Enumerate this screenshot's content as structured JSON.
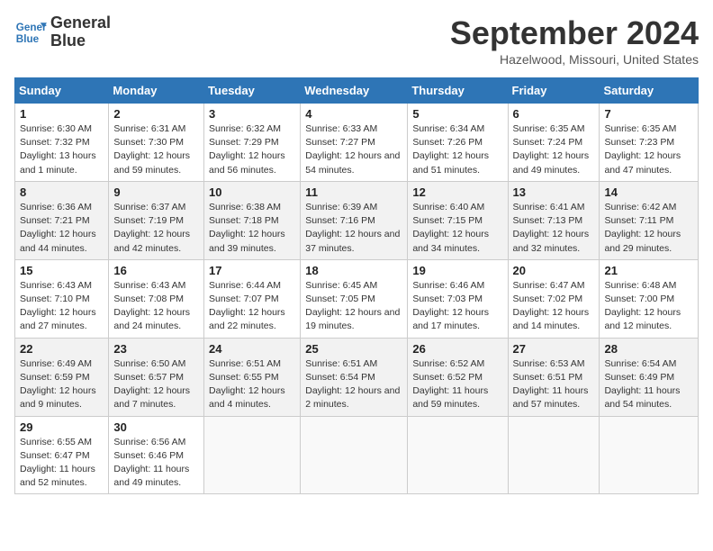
{
  "logo": {
    "line1": "General",
    "line2": "Blue"
  },
  "title": "September 2024",
  "location": "Hazelwood, Missouri, United States",
  "days_of_week": [
    "Sunday",
    "Monday",
    "Tuesday",
    "Wednesday",
    "Thursday",
    "Friday",
    "Saturday"
  ],
  "weeks": [
    [
      {
        "day": "1",
        "sunrise": "6:30 AM",
        "sunset": "7:32 PM",
        "daylight": "13 hours and 1 minute."
      },
      {
        "day": "2",
        "sunrise": "6:31 AM",
        "sunset": "7:30 PM",
        "daylight": "12 hours and 59 minutes."
      },
      {
        "day": "3",
        "sunrise": "6:32 AM",
        "sunset": "7:29 PM",
        "daylight": "12 hours and 56 minutes."
      },
      {
        "day": "4",
        "sunrise": "6:33 AM",
        "sunset": "7:27 PM",
        "daylight": "12 hours and 54 minutes."
      },
      {
        "day": "5",
        "sunrise": "6:34 AM",
        "sunset": "7:26 PM",
        "daylight": "12 hours and 51 minutes."
      },
      {
        "day": "6",
        "sunrise": "6:35 AM",
        "sunset": "7:24 PM",
        "daylight": "12 hours and 49 minutes."
      },
      {
        "day": "7",
        "sunrise": "6:35 AM",
        "sunset": "7:23 PM",
        "daylight": "12 hours and 47 minutes."
      }
    ],
    [
      {
        "day": "8",
        "sunrise": "6:36 AM",
        "sunset": "7:21 PM",
        "daylight": "12 hours and 44 minutes."
      },
      {
        "day": "9",
        "sunrise": "6:37 AM",
        "sunset": "7:19 PM",
        "daylight": "12 hours and 42 minutes."
      },
      {
        "day": "10",
        "sunrise": "6:38 AM",
        "sunset": "7:18 PM",
        "daylight": "12 hours and 39 minutes."
      },
      {
        "day": "11",
        "sunrise": "6:39 AM",
        "sunset": "7:16 PM",
        "daylight": "12 hours and 37 minutes."
      },
      {
        "day": "12",
        "sunrise": "6:40 AM",
        "sunset": "7:15 PM",
        "daylight": "12 hours and 34 minutes."
      },
      {
        "day": "13",
        "sunrise": "6:41 AM",
        "sunset": "7:13 PM",
        "daylight": "12 hours and 32 minutes."
      },
      {
        "day": "14",
        "sunrise": "6:42 AM",
        "sunset": "7:11 PM",
        "daylight": "12 hours and 29 minutes."
      }
    ],
    [
      {
        "day": "15",
        "sunrise": "6:43 AM",
        "sunset": "7:10 PM",
        "daylight": "12 hours and 27 minutes."
      },
      {
        "day": "16",
        "sunrise": "6:43 AM",
        "sunset": "7:08 PM",
        "daylight": "12 hours and 24 minutes."
      },
      {
        "day": "17",
        "sunrise": "6:44 AM",
        "sunset": "7:07 PM",
        "daylight": "12 hours and 22 minutes."
      },
      {
        "day": "18",
        "sunrise": "6:45 AM",
        "sunset": "7:05 PM",
        "daylight": "12 hours and 19 minutes."
      },
      {
        "day": "19",
        "sunrise": "6:46 AM",
        "sunset": "7:03 PM",
        "daylight": "12 hours and 17 minutes."
      },
      {
        "day": "20",
        "sunrise": "6:47 AM",
        "sunset": "7:02 PM",
        "daylight": "12 hours and 14 minutes."
      },
      {
        "day": "21",
        "sunrise": "6:48 AM",
        "sunset": "7:00 PM",
        "daylight": "12 hours and 12 minutes."
      }
    ],
    [
      {
        "day": "22",
        "sunrise": "6:49 AM",
        "sunset": "6:59 PM",
        "daylight": "12 hours and 9 minutes."
      },
      {
        "day": "23",
        "sunrise": "6:50 AM",
        "sunset": "6:57 PM",
        "daylight": "12 hours and 7 minutes."
      },
      {
        "day": "24",
        "sunrise": "6:51 AM",
        "sunset": "6:55 PM",
        "daylight": "12 hours and 4 minutes."
      },
      {
        "day": "25",
        "sunrise": "6:51 AM",
        "sunset": "6:54 PM",
        "daylight": "12 hours and 2 minutes."
      },
      {
        "day": "26",
        "sunrise": "6:52 AM",
        "sunset": "6:52 PM",
        "daylight": "11 hours and 59 minutes."
      },
      {
        "day": "27",
        "sunrise": "6:53 AM",
        "sunset": "6:51 PM",
        "daylight": "11 hours and 57 minutes."
      },
      {
        "day": "28",
        "sunrise": "6:54 AM",
        "sunset": "6:49 PM",
        "daylight": "11 hours and 54 minutes."
      }
    ],
    [
      {
        "day": "29",
        "sunrise": "6:55 AM",
        "sunset": "6:47 PM",
        "daylight": "11 hours and 52 minutes."
      },
      {
        "day": "30",
        "sunrise": "6:56 AM",
        "sunset": "6:46 PM",
        "daylight": "11 hours and 49 minutes."
      },
      null,
      null,
      null,
      null,
      null
    ]
  ]
}
